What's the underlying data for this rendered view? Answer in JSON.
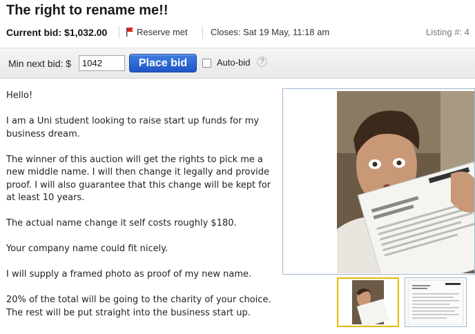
{
  "listing": {
    "title": "The right to rename me!!",
    "current_bid": "Current bid: $1,032.00",
    "reserve": "Reserve met",
    "closes": "Closes: Sat 19 May, 11:18 am",
    "listing_number": "Listing #: 4"
  },
  "bid_bar": {
    "min_next_label": "Min next bid:  $",
    "min_next_value": "1042",
    "place_bid_label": "Place bid",
    "auto_bid_label": "Auto-bid",
    "help_glyph": "?"
  },
  "description": [
    "Hello!",
    "I am a Uni student looking to raise start up funds for my business dream.",
    "The winner of this auction will get the rights to pick me a new middle name. I will then change it legally and provide proof. I will also guarantee that this change will be kept for at least 10 years.",
    "The actual name change it self costs roughly $180.",
    "Your company name could fit nicely.",
    "I will supply a framed photo as proof of my new name.",
    "20% of the total will be going to the charity of your choice. The rest will be put straight into the business start up."
  ],
  "colors": {
    "place_bid": "#1f56c5",
    "reserve_flag": "#d9231c",
    "selected_thumb_border": "#e6b800"
  },
  "icons": {
    "reserve": "flag-icon",
    "help": "help-icon"
  }
}
